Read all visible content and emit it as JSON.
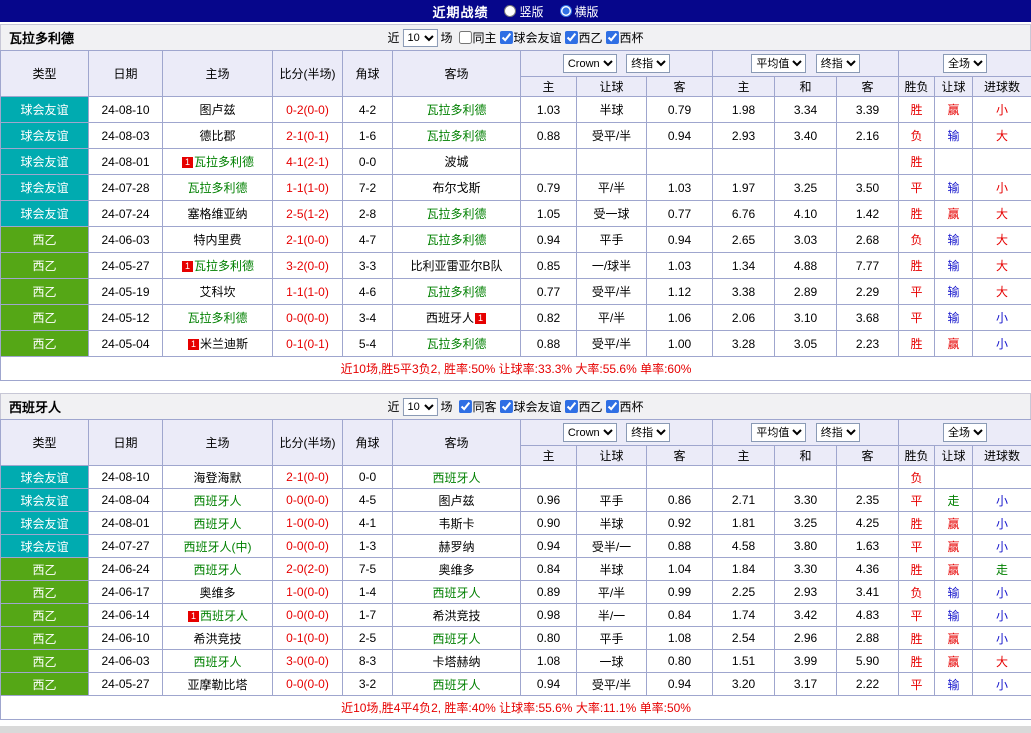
{
  "topbar": {
    "title": "近期战绩",
    "layout_options": [
      {
        "label": "竖版",
        "selected": false
      },
      {
        "label": "横版",
        "selected": true
      }
    ]
  },
  "colors": {
    "red": "#e60000",
    "blue": "#1616cc",
    "green": "#008000",
    "black": "#000000",
    "type_friendly": "#00abb0",
    "type_league": "#55a716",
    "navy": "#06068b",
    "border": "#9fa6ce",
    "header_bg": "#ebebf8"
  },
  "table_header": {
    "cols": [
      "类型",
      "日期",
      "主场",
      "比分(半场)",
      "角球",
      "客场"
    ],
    "sub_asia": [
      "主",
      "让球",
      "客"
    ],
    "sub_europe": [
      "主",
      "和",
      "客"
    ],
    "sub_result": [
      "胜负",
      "让球",
      "进球数"
    ],
    "select_bookmaker": "Crown",
    "select_asia_stage": "终指",
    "select_average": "平均值",
    "select_europe_stage": "终指",
    "select_fulltime": "全场"
  },
  "sections": [
    {
      "team": "瓦拉多利德",
      "filter": {
        "near": "近",
        "count": "10",
        "unit": "场",
        "checks": [
          {
            "label": "同主",
            "checked": false
          },
          {
            "label": "球会友谊",
            "checked": true
          },
          {
            "label": "西乙",
            "checked": true
          },
          {
            "label": "西杯",
            "checked": true
          }
        ]
      },
      "rows": [
        {
          "type": "球会友谊",
          "tc": "type_friendly",
          "date": "24-08-10",
          "home": {
            "name": "图卢兹",
            "color": "black"
          },
          "score": "0-2(0-0)",
          "corner": "4-2",
          "away": {
            "name": "瓦拉多利德",
            "color": "green"
          },
          "ah": [
            "1.03",
            "半球",
            "0.79"
          ],
          "eu": [
            "1.98",
            "3.34",
            "3.39"
          ],
          "res": [
            {
              "t": "胜",
              "c": "red"
            },
            {
              "t": "赢",
              "c": "red"
            },
            {
              "t": "小",
              "c": "red"
            }
          ]
        },
        {
          "type": "球会友谊",
          "tc": "type_friendly",
          "date": "24-08-03",
          "home": {
            "name": "德比郡",
            "color": "black"
          },
          "score": "2-1(0-1)",
          "corner": "1-6",
          "away": {
            "name": "瓦拉多利德",
            "color": "green"
          },
          "ah": [
            "0.88",
            "受平/半",
            "0.94"
          ],
          "eu": [
            "2.93",
            "3.40",
            "2.16"
          ],
          "res": [
            {
              "t": "负",
              "c": "red"
            },
            {
              "t": "输",
              "c": "blue"
            },
            {
              "t": "大",
              "c": "red"
            }
          ]
        },
        {
          "type": "球会友谊",
          "tc": "type_friendly",
          "date": "24-08-01",
          "home": {
            "name": "瓦拉多利德",
            "color": "green",
            "b1": "1"
          },
          "score": "4-1(2-1)",
          "corner": "0-0",
          "away": {
            "name": "波城",
            "color": "black"
          },
          "ah": [
            "",
            "",
            ""
          ],
          "eu": [
            "",
            "",
            ""
          ],
          "res": [
            {
              "t": "胜",
              "c": "red"
            },
            {
              "t": "",
              "c": "black"
            },
            {
              "t": "",
              "c": "black"
            }
          ]
        },
        {
          "type": "球会友谊",
          "tc": "type_friendly",
          "date": "24-07-28",
          "home": {
            "name": "瓦拉多利德",
            "color": "green"
          },
          "score": "1-1(1-0)",
          "corner": "7-2",
          "away": {
            "name": "布尔戈斯",
            "color": "black"
          },
          "ah": [
            "0.79",
            "平/半",
            "1.03"
          ],
          "eu": [
            "1.97",
            "3.25",
            "3.50"
          ],
          "res": [
            {
              "t": "平",
              "c": "red"
            },
            {
              "t": "输",
              "c": "blue"
            },
            {
              "t": "小",
              "c": "red"
            }
          ]
        },
        {
          "type": "球会友谊",
          "tc": "type_friendly",
          "date": "24-07-24",
          "home": {
            "name": "塞格维亚纳",
            "color": "black"
          },
          "score": "2-5(1-2)",
          "corner": "2-8",
          "away": {
            "name": "瓦拉多利德",
            "color": "green"
          },
          "ah": [
            "1.05",
            "受一球",
            "0.77"
          ],
          "eu": [
            "6.76",
            "4.10",
            "1.42"
          ],
          "res": [
            {
              "t": "胜",
              "c": "red"
            },
            {
              "t": "赢",
              "c": "red"
            },
            {
              "t": "大",
              "c": "red"
            }
          ]
        },
        {
          "type": "西乙",
          "tc": "type_league",
          "date": "24-06-03",
          "home": {
            "name": "特内里费",
            "color": "black"
          },
          "score": "2-1(0-0)",
          "corner": "4-7",
          "away": {
            "name": "瓦拉多利德",
            "color": "green"
          },
          "ah": [
            "0.94",
            "平手",
            "0.94"
          ],
          "eu": [
            "2.65",
            "3.03",
            "2.68"
          ],
          "res": [
            {
              "t": "负",
              "c": "red"
            },
            {
              "t": "输",
              "c": "blue"
            },
            {
              "t": "大",
              "c": "red"
            }
          ]
        },
        {
          "type": "西乙",
          "tc": "type_league",
          "date": "24-05-27",
          "home": {
            "name": "瓦拉多利德",
            "color": "green",
            "b1": "1"
          },
          "score": "3-2(0-0)",
          "corner": "3-3",
          "away": {
            "name": "比利亚雷亚尔B队",
            "color": "black"
          },
          "ah": [
            "0.85",
            "一/球半",
            "1.03"
          ],
          "eu": [
            "1.34",
            "4.88",
            "7.77"
          ],
          "res": [
            {
              "t": "胜",
              "c": "red"
            },
            {
              "t": "输",
              "c": "blue"
            },
            {
              "t": "大",
              "c": "red"
            }
          ]
        },
        {
          "type": "西乙",
          "tc": "type_league",
          "date": "24-05-19",
          "home": {
            "name": "艾科坎",
            "color": "black"
          },
          "score": "1-1(1-0)",
          "corner": "4-6",
          "away": {
            "name": "瓦拉多利德",
            "color": "green"
          },
          "ah": [
            "0.77",
            "受平/半",
            "1.12"
          ],
          "eu": [
            "3.38",
            "2.89",
            "2.29"
          ],
          "res": [
            {
              "t": "平",
              "c": "red"
            },
            {
              "t": "输",
              "c": "blue"
            },
            {
              "t": "大",
              "c": "red"
            }
          ]
        },
        {
          "type": "西乙",
          "tc": "type_league",
          "date": "24-05-12",
          "home": {
            "name": "瓦拉多利德",
            "color": "green"
          },
          "score": "0-0(0-0)",
          "corner": "3-4",
          "away": {
            "name": "西班牙人",
            "color": "black",
            "b2": "1"
          },
          "ah": [
            "0.82",
            "平/半",
            "1.06"
          ],
          "eu": [
            "2.06",
            "3.10",
            "3.68"
          ],
          "res": [
            {
              "t": "平",
              "c": "red"
            },
            {
              "t": "输",
              "c": "blue"
            },
            {
              "t": "小",
              "c": "blue"
            }
          ]
        },
        {
          "type": "西乙",
          "tc": "type_league",
          "date": "24-05-04",
          "home": {
            "name": "米兰迪斯",
            "color": "black",
            "b1": "1"
          },
          "score": "0-1(0-1)",
          "corner": "5-4",
          "away": {
            "name": "瓦拉多利德",
            "color": "green"
          },
          "ah": [
            "0.88",
            "受平/半",
            "1.00"
          ],
          "eu": [
            "3.28",
            "3.05",
            "2.23"
          ],
          "res": [
            {
              "t": "胜",
              "c": "red"
            },
            {
              "t": "赢",
              "c": "red"
            },
            {
              "t": "小",
              "c": "blue"
            }
          ]
        }
      ],
      "summary": "近10场,胜5平3负2, 胜率:50% 让球率:33.3% 大率:55.6% 单率:60%"
    },
    {
      "team": "西班牙人",
      "filter": {
        "near": "近",
        "count": "10",
        "unit": "场",
        "checks": [
          {
            "label": "同客",
            "checked": true
          },
          {
            "label": "球会友谊",
            "checked": true
          },
          {
            "label": "西乙",
            "checked": true
          },
          {
            "label": "西杯",
            "checked": true
          }
        ]
      },
      "rows": [
        {
          "type": "球会友谊",
          "tc": "type_friendly",
          "date": "24-08-10",
          "home": {
            "name": "海登海默",
            "color": "black"
          },
          "score": "2-1(0-0)",
          "corner": "0-0",
          "away": {
            "name": "西班牙人",
            "color": "green"
          },
          "ah": [
            "",
            "",
            ""
          ],
          "eu": [
            "",
            "",
            ""
          ],
          "res": [
            {
              "t": "负",
              "c": "red"
            },
            {
              "t": "",
              "c": "black"
            },
            {
              "t": "",
              "c": "black"
            }
          ]
        },
        {
          "type": "球会友谊",
          "tc": "type_friendly",
          "date": "24-08-04",
          "home": {
            "name": "西班牙人",
            "color": "green"
          },
          "score": "0-0(0-0)",
          "corner": "4-5",
          "away": {
            "name": "图卢兹",
            "color": "black"
          },
          "ah": [
            "0.96",
            "平手",
            "0.86"
          ],
          "eu": [
            "2.71",
            "3.30",
            "2.35"
          ],
          "res": [
            {
              "t": "平",
              "c": "red"
            },
            {
              "t": "走",
              "c": "green"
            },
            {
              "t": "小",
              "c": "blue"
            }
          ]
        },
        {
          "type": "球会友谊",
          "tc": "type_friendly",
          "date": "24-08-01",
          "home": {
            "name": "西班牙人",
            "color": "green"
          },
          "score": "1-0(0-0)",
          "corner": "4-1",
          "away": {
            "name": "韦斯卡",
            "color": "black"
          },
          "ah": [
            "0.90",
            "半球",
            "0.92"
          ],
          "eu": [
            "1.81",
            "3.25",
            "4.25"
          ],
          "res": [
            {
              "t": "胜",
              "c": "red"
            },
            {
              "t": "赢",
              "c": "red"
            },
            {
              "t": "小",
              "c": "blue"
            }
          ]
        },
        {
          "type": "球会友谊",
          "tc": "type_friendly",
          "date": "24-07-27",
          "home": {
            "name": "西班牙人(中)",
            "color": "green"
          },
          "score": "0-0(0-0)",
          "corner": "1-3",
          "away": {
            "name": "赫罗纳",
            "color": "black"
          },
          "ah": [
            "0.94",
            "受半/一",
            "0.88"
          ],
          "eu": [
            "4.58",
            "3.80",
            "1.63"
          ],
          "res": [
            {
              "t": "平",
              "c": "red"
            },
            {
              "t": "赢",
              "c": "red"
            },
            {
              "t": "小",
              "c": "blue"
            }
          ]
        },
        {
          "type": "西乙",
          "tc": "type_league",
          "date": "24-06-24",
          "home": {
            "name": "西班牙人",
            "color": "green"
          },
          "score": "2-0(2-0)",
          "corner": "7-5",
          "away": {
            "name": "奥维多",
            "color": "black"
          },
          "ah": [
            "0.84",
            "半球",
            "1.04"
          ],
          "eu": [
            "1.84",
            "3.30",
            "4.36"
          ],
          "res": [
            {
              "t": "胜",
              "c": "red"
            },
            {
              "t": "赢",
              "c": "red"
            },
            {
              "t": "走",
              "c": "green"
            }
          ]
        },
        {
          "type": "西乙",
          "tc": "type_league",
          "date": "24-06-17",
          "home": {
            "name": "奥维多",
            "color": "black"
          },
          "score": "1-0(0-0)",
          "corner": "1-4",
          "away": {
            "name": "西班牙人",
            "color": "green"
          },
          "ah": [
            "0.89",
            "平/半",
            "0.99"
          ],
          "eu": [
            "2.25",
            "2.93",
            "3.41"
          ],
          "res": [
            {
              "t": "负",
              "c": "red"
            },
            {
              "t": "输",
              "c": "blue"
            },
            {
              "t": "小",
              "c": "blue"
            }
          ]
        },
        {
          "type": "西乙",
          "tc": "type_league",
          "date": "24-06-14",
          "home": {
            "name": "西班牙人",
            "color": "green",
            "b1": "1"
          },
          "score": "0-0(0-0)",
          "corner": "1-7",
          "away": {
            "name": "希洪竞技",
            "color": "black"
          },
          "ah": [
            "0.98",
            "半/一",
            "0.84"
          ],
          "eu": [
            "1.74",
            "3.42",
            "4.83"
          ],
          "res": [
            {
              "t": "平",
              "c": "red"
            },
            {
              "t": "输",
              "c": "blue"
            },
            {
              "t": "小",
              "c": "blue"
            }
          ]
        },
        {
          "type": "西乙",
          "tc": "type_league",
          "date": "24-06-10",
          "home": {
            "name": "希洪竞技",
            "color": "black"
          },
          "score": "0-1(0-0)",
          "corner": "2-5",
          "away": {
            "name": "西班牙人",
            "color": "green"
          },
          "ah": [
            "0.80",
            "平手",
            "1.08"
          ],
          "eu": [
            "2.54",
            "2.96",
            "2.88"
          ],
          "res": [
            {
              "t": "胜",
              "c": "red"
            },
            {
              "t": "赢",
              "c": "red"
            },
            {
              "t": "小",
              "c": "blue"
            }
          ]
        },
        {
          "type": "西乙",
          "tc": "type_league",
          "date": "24-06-03",
          "home": {
            "name": "西班牙人",
            "color": "green"
          },
          "score": "3-0(0-0)",
          "corner": "8-3",
          "away": {
            "name": "卡塔赫纳",
            "color": "black"
          },
          "ah": [
            "1.08",
            "一球",
            "0.80"
          ],
          "eu": [
            "1.51",
            "3.99",
            "5.90"
          ],
          "res": [
            {
              "t": "胜",
              "c": "red"
            },
            {
              "t": "赢",
              "c": "red"
            },
            {
              "t": "大",
              "c": "red"
            }
          ]
        },
        {
          "type": "西乙",
          "tc": "type_league",
          "date": "24-05-27",
          "home": {
            "name": "亚摩勒比塔",
            "color": "black"
          },
          "score": "0-0(0-0)",
          "corner": "3-2",
          "away": {
            "name": "西班牙人",
            "color": "green"
          },
          "ah": [
            "0.94",
            "受平/半",
            "0.94"
          ],
          "eu": [
            "3.20",
            "3.17",
            "2.22"
          ],
          "res": [
            {
              "t": "平",
              "c": "red"
            },
            {
              "t": "输",
              "c": "blue"
            },
            {
              "t": "小",
              "c": "blue"
            }
          ]
        }
      ],
      "summary": "近10场,胜4平4负2, 胜率:40% 让球率:55.6% 大率:11.1% 单率:50%"
    }
  ]
}
